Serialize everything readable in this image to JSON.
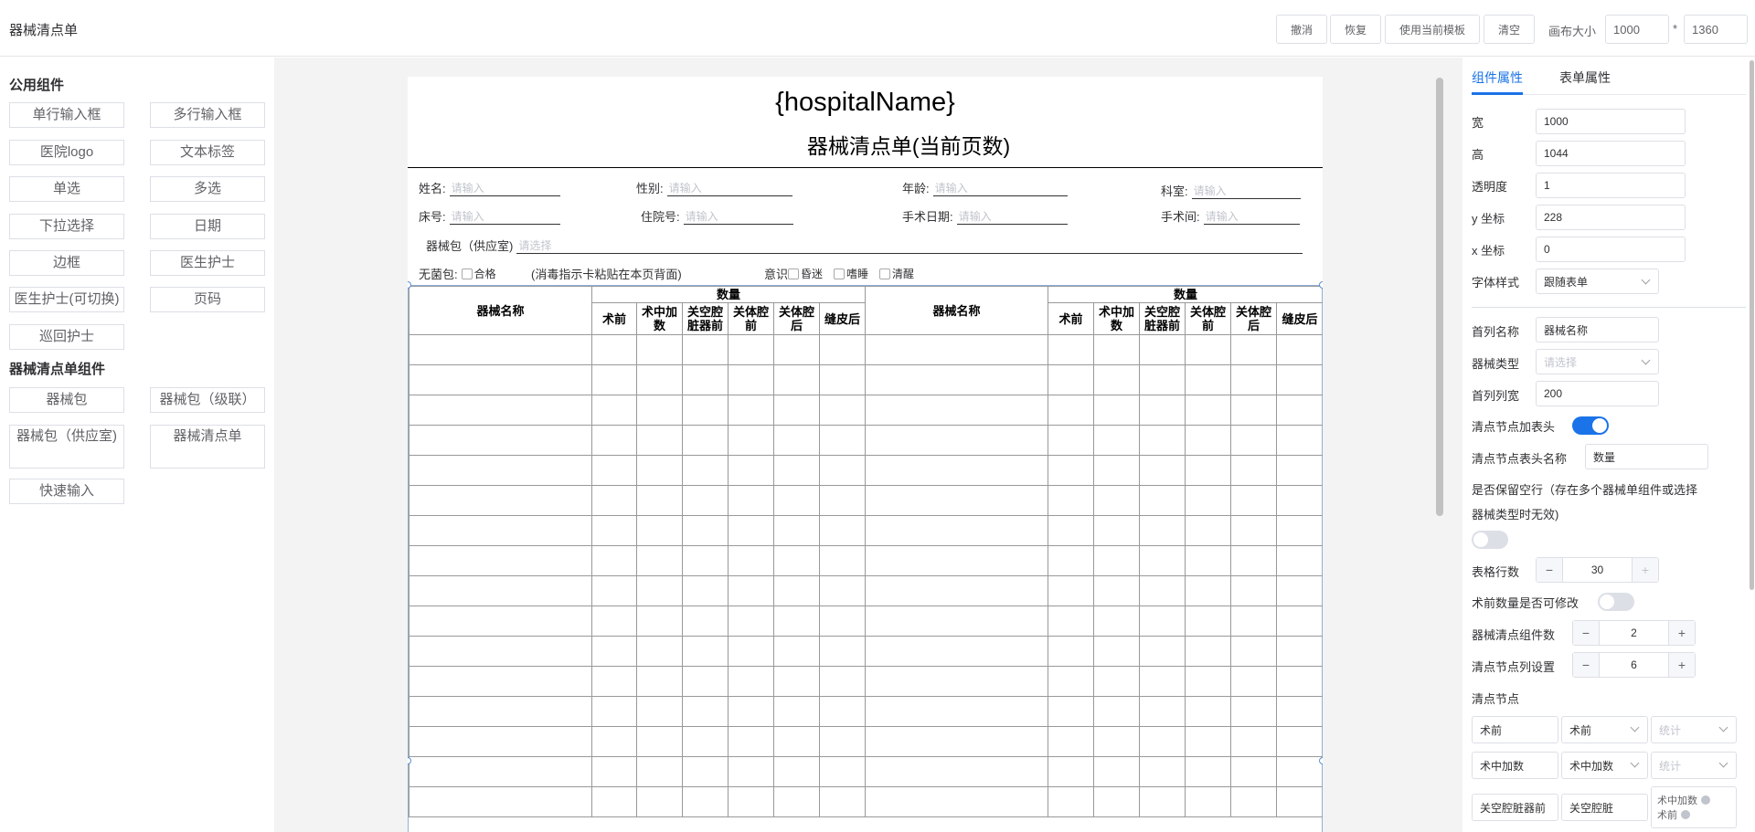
{
  "app": {
    "title": "器械清点单"
  },
  "toolbar": {
    "undo": "撤消",
    "redo": "恢复",
    "use_template": "使用当前模板",
    "clear": "清空",
    "canvas_size_label": "画布大小",
    "canvas_width": "1000",
    "times": "*",
    "canvas_height": "1360"
  },
  "left": {
    "public_title": "公用组件",
    "public_items": [
      "单行输入框",
      "多行输入框",
      "医院logo",
      "文本标签",
      "单选",
      "多选",
      "下拉选择",
      "日期",
      "边框",
      "医生护士",
      "医生护士(可切换)",
      "页码",
      "巡回护士"
    ],
    "sheet_title": "器械清点单组件",
    "sheet_items": [
      "器械包",
      "器械包（级联）",
      "器械包（供应室)",
      "器械清点单",
      "快速输入"
    ]
  },
  "paper": {
    "hospital_name": "{hospitalName}",
    "title": "器械清点单(当前页数)",
    "placeholder": "请输入",
    "select_placeholder": "请选择",
    "fields": {
      "name": "姓名:",
      "gender": "性别:",
      "age": "年龄:",
      "dept": "科室:",
      "bed": "床号:",
      "inpatient": "住院号:",
      "surgery_date": "手术日期:",
      "or_room": "手术间:",
      "kit": "器械包（供应室)"
    },
    "sterile_label": "无菌包:",
    "sterile_ok": "合格",
    "sterile_note": "(消毒指示卡粘贴在本页背面)",
    "conscious_label": "意识",
    "conscious_options": [
      "昏迷",
      "嗜睡",
      "清醒"
    ],
    "table": {
      "name_col": "器械名称",
      "group_header": "数量",
      "sub_cols": [
        "术前",
        "术中加数",
        "关空腔脏器前",
        "关体腔前",
        "关体腔后",
        "缝皮后"
      ],
      "visible_rows": 16
    }
  },
  "right": {
    "tabs": [
      "组件属性",
      "表单属性"
    ],
    "width_label": "宽",
    "width_value": "1000",
    "height_label": "高",
    "height_value": "1044",
    "opacity_label": "透明度",
    "opacity_value": "1",
    "y_label": "y 坐标",
    "y_value": "228",
    "x_label": "x 坐标",
    "x_value": "0",
    "font_style_label": "字体样式",
    "font_style_value": "跟随表单",
    "first_col_name_label": "首列名称",
    "first_col_name_value": "器械名称",
    "kit_type_label": "器械类型",
    "kit_type_placeholder": "请选择",
    "first_col_width_label": "首列列宽",
    "first_col_width_value": "200",
    "node_header_label": "清点节点加表头",
    "node_header_on": true,
    "node_header_name_label": "清点节点表头名称",
    "node_header_name_value": "数量",
    "keep_empty_label_1": "是否保留空行（存在多个器械单组件或选择",
    "keep_empty_label_2": "器械类型时无效)",
    "keep_empty_on": false,
    "rows_label": "表格行数",
    "rows_value": "30",
    "pre_editable_label": "术前数量是否可修改",
    "pre_editable_on": false,
    "component_count_label": "器械清点组件数",
    "component_count_value": "2",
    "node_cols_label": "清点节点列设置",
    "node_cols_value": "6",
    "nodes_label": "清点节点",
    "stat_placeholder": "统计",
    "nodes": [
      {
        "name": "术前",
        "type": "术前",
        "tags": []
      },
      {
        "name": "术中加数",
        "type": "术中加数",
        "tags": []
      },
      {
        "name": "关空腔脏器前",
        "type": "关空腔脏",
        "tags": [
          "术中加数",
          "术前"
        ]
      }
    ],
    "minus": "−",
    "plus": "+"
  }
}
